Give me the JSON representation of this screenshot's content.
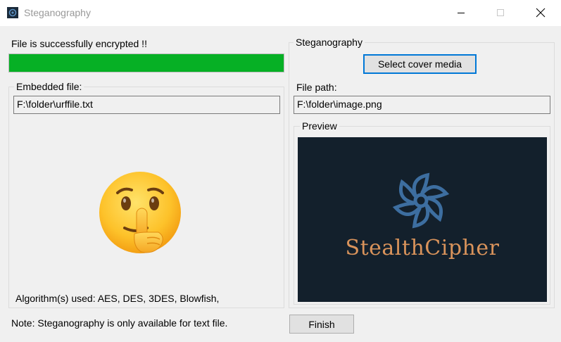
{
  "window": {
    "title": "Steganography",
    "icon": "app-cipher-icon"
  },
  "status": {
    "message": "File is successfully encrypted !!",
    "progress_percent": 100,
    "progress_color": "#06b025"
  },
  "embedded": {
    "group_label": "Embedded file:",
    "file_path": "F:\\folder\\urffile.txt",
    "emoji": "shushing-face-icon",
    "algorithms_text": "Algorithm(s) used: AES, DES, 3DES, Blowfish,"
  },
  "steganography": {
    "group_label": "Steganography",
    "select_button_label": "Select cover media",
    "file_path_label": "File path:",
    "file_path": "F:\\folder\\image.png",
    "preview_label": "Preview",
    "preview_brand_text": "StealthCipher",
    "preview_bg_color": "#13202c",
    "preview_logo_color": "#3d6ea0",
    "preview_text_color": "#d9935b"
  },
  "footer": {
    "note": "Note: Steganography is only available for text file.",
    "finish_label": "Finish"
  }
}
